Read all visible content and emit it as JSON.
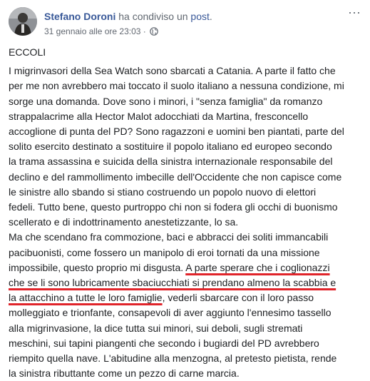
{
  "post": {
    "author": "Stefano Doroni",
    "action_text": "ha condiviso un",
    "action_link": "post",
    "timestamp": "31 gennaio alle ore 23:03",
    "separator": "·",
    "more_glyph": "···",
    "body": {
      "heading": "ECCOLI",
      "p1": [
        "I migrinvasori della Sea Watch sono sbarcati a Catania. A parte il fatto che",
        "per me non avrebbero mai toccato il suolo italiano a nessuna condizione, mi",
        "sorge una domanda. Dove sono i minori, i \"senza famiglia\" da romanzo",
        "strappalacrime alla Hector Malot adocchiati da Martina, fresconcello",
        "accoglione di punta del PD? Sono ragazzoni e uomini ben piantati, parte del",
        "solito esercito destinato a sostituire il popolo italiano ed europeo secondo",
        "la trama assassina e suicida della sinistra internazionale responsabile del",
        "declino e del rammollimento imbecille dell'Occidente che non capisce come",
        "le sinistre allo sbando si stiano costruendo un popolo nuovo di elettori",
        "fedeli. Tutto bene, questo purtroppo chi non si fodera gli occhi di buonismo",
        "scellerato e di indottrinamento anestetizzante, lo sa."
      ],
      "p2": {
        "l1": "Ma che scendano fra commozione, baci e abbracci dei soliti immancabili",
        "l2": "pacibuonisti, come fossero un manipolo di eroi tornati da una missione",
        "l3_plain": "impossibile, questo proprio mi disgusta. ",
        "l3_marked": "A parte sperare che i coglionazzi",
        "l4_marked": "che se li sono lubricamente sbaciucchiati si prendano almeno la scabbia e",
        "l5_marked": "la attacchino a tutte le loro famiglie",
        "l5_plain": ", vederli sbarcare con il loro passo",
        "rest": [
          "molleggiato e trionfante, consapevoli di aver aggiunto l'ennesimo tassello",
          "alla migrinvasione, la dice tutta sui minori, sui deboli, sugli stremati",
          "meschini, sui tapini piangenti che secondo i bugiardi del PD avrebbero",
          "riempito quella nave. L'abitudine alla menzogna, al pretesto pietista, rende",
          "la sinistra ributtante come un pezzo di carne marcia."
        ]
      }
    }
  },
  "colors": {
    "name_link": "#385898",
    "text": "#1c1e21",
    "secondary": "#616770",
    "highlight_underline": "#e0242a"
  },
  "icons": {
    "privacy": "globe-icon",
    "options": "more-options-icon"
  }
}
